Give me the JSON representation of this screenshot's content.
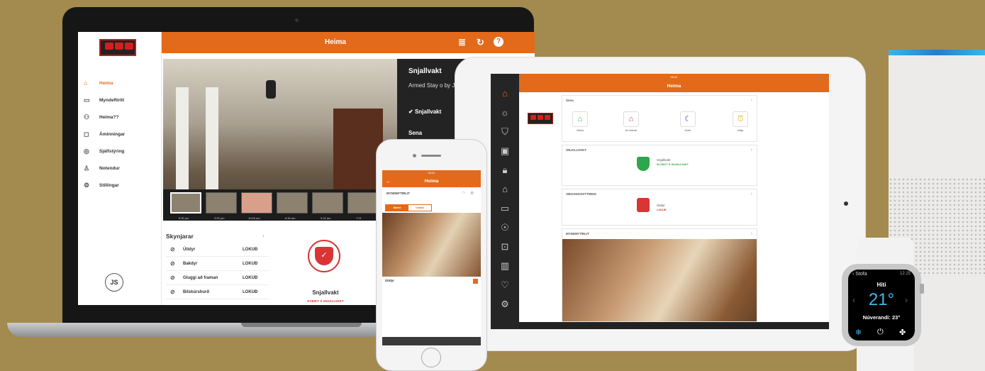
{
  "laptop": {
    "header_title": "Heima",
    "nav": [
      {
        "label": "Heima",
        "icon": "home-icon",
        "active": true
      },
      {
        "label": "Myndeftirlit",
        "icon": "camera-icon"
      },
      {
        "label": "Heima??",
        "icon": "people-icon"
      },
      {
        "label": "Áminningar",
        "icon": "reminder-icon"
      },
      {
        "label": "Sjálfstýring",
        "icon": "automation-icon"
      },
      {
        "label": "Notendur",
        "icon": "users-icon"
      },
      {
        "label": "Stillingar",
        "icon": "gear-icon"
      }
    ],
    "avatar": "JS",
    "thumb_times": [
      "6:30 pm",
      "3:00 pm",
      "10:06 am",
      "8:35 am",
      "9:32 am",
      "7:21"
    ],
    "alarm_panel": {
      "title": "Snjallvakt",
      "subtitle": "Armed Stay o by John",
      "check_label": "Snjallvakt",
      "section": "Sena"
    },
    "sensors": {
      "title": "Skynjarar",
      "rows": [
        {
          "name": "Útidyr",
          "status": "LOKUÐ"
        },
        {
          "name": "Bakdyr",
          "status": "LOKUÐ"
        },
        {
          "name": "Gluggi að framan",
          "status": "LOKUÐ"
        },
        {
          "name": "Bílskúrshurð",
          "status": "LOKUÐ"
        }
      ]
    },
    "alarm_card": {
      "title": "Snjallvakt",
      "status": "KVEIKT Á SNJALLVAKT"
    }
  },
  "tablet": {
    "status_time": "09:41",
    "header_title": "Heima",
    "sena_title": "Sena",
    "scenes": [
      "Heima",
      "Að heiman",
      "Svefn",
      "Vekja"
    ],
    "snjallvakt_section": "SNJALLVAKT",
    "snjallvakt_label": "Snjallvakt",
    "snjallvakt_status": "SLÖKKT Á SNJALLVAKT",
    "access_section": "AÐGANGSSTÝRING",
    "access_label": "Útidyr",
    "access_status": "LOKUÐ",
    "camera_section": "MYNDEFTIRLIT"
  },
  "phone": {
    "status_time": "09:41",
    "header_title": "Heima",
    "section": "MYNDEFTIRLIT",
    "tabs": [
      "Beint",
      "Vistað"
    ],
    "caption": "Útidyr"
  },
  "watch": {
    "back_label": "Stofa",
    "time": "12:15",
    "mode": "Hiti",
    "setpoint": "21°",
    "current": "Núverandi: 23°"
  },
  "colors": {
    "brand_orange": "#e36a1a",
    "alarm_red": "#d93535",
    "ok_green": "#2ea64b",
    "watch_blue": "#3fb6ea"
  }
}
